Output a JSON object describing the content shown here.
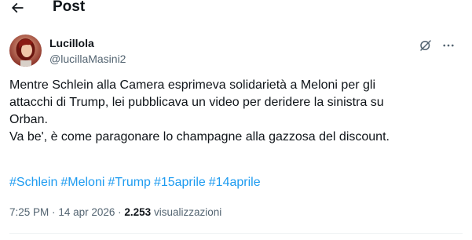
{
  "header": {
    "back_icon": "arrow-left-icon",
    "title": "Post"
  },
  "author": {
    "display_name": "Lucillola",
    "handle": "@lucillaMasini2",
    "avatar_icon": "avatar-photo"
  },
  "actions": {
    "grok_icon": "grok-icon",
    "more_icon": "more-dots-icon"
  },
  "post": {
    "lines": [
      "Mentre Schlein alla Camera esprimeva solidarietà a Meloni per gli",
      "attacchi di Trump, lei pubblicava un video per deridere la sinistra su",
      "Orban.",
      "Va be', è come paragonare lo champagne alla gazzosa del discount."
    ],
    "hashtags": [
      "#Schlein",
      "#Meloni",
      "#Trump",
      "#15aprile",
      "#14aprile"
    ]
  },
  "meta": {
    "time": "7:25 PM",
    "separator": "·",
    "date": "14 apr 2026",
    "views_count": "2.253",
    "views_label": "visualizzazioni"
  },
  "colors": {
    "text": "#0f1419",
    "secondary": "#536471",
    "link": "#1d9bf0",
    "divider": "#eff3f4"
  }
}
